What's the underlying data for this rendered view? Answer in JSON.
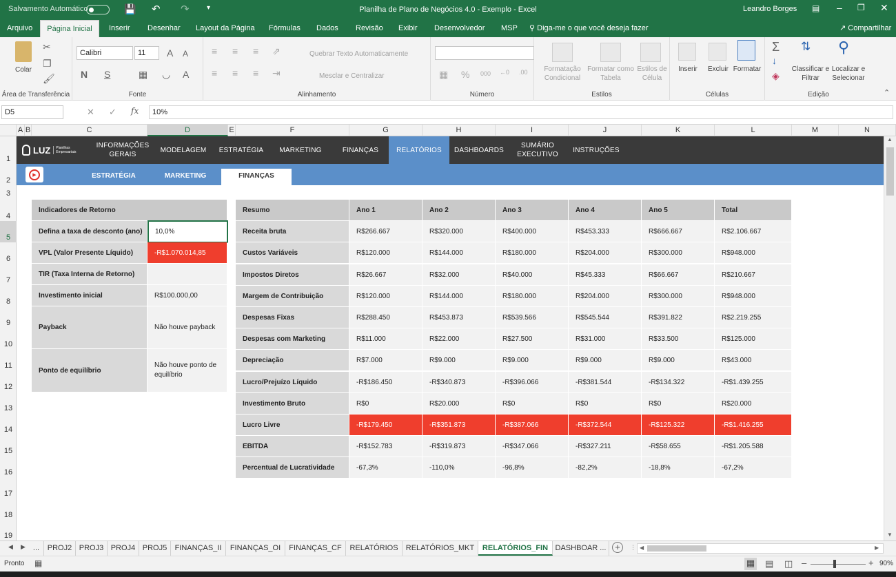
{
  "titlebar": {
    "autosave": "Salvamento Automático",
    "title": "Planilha de Plano de Negócios 4.0 - Exemplo  -  Excel",
    "user": "Leandro Borges"
  },
  "ribbon_tabs": [
    "Arquivo",
    "Página Inicial",
    "Inserir",
    "Desenhar",
    "Layout da Página",
    "Fórmulas",
    "Dados",
    "Revisão",
    "Exibir",
    "Desenvolvedor",
    "MSP"
  ],
  "tell_me": "Diga-me o que você deseja fazer",
  "share": "Compartilhar",
  "ribbon": {
    "paste": "Colar",
    "clipboard": "Área de Transferência",
    "font_name": "Calibri",
    "font_size": "11",
    "font_group": "Fonte",
    "wrap": "Quebrar Texto Automaticamente",
    "merge": "Mesclar e Centralizar",
    "align_group": "Alinhamento",
    "number_group": "Número",
    "cond_format": "Formatação Condicional",
    "format_table": "Formatar como Tabela",
    "cell_styles": "Estilos de Célula",
    "styles_group": "Estilos",
    "insert": "Inserir",
    "delete": "Excluir",
    "format": "Formatar",
    "cells_group": "Células",
    "sort": "Classificar e Filtrar",
    "find": "Localizar e Selecionar",
    "edit_group": "Edição"
  },
  "formula": {
    "namebox": "D5",
    "fx": "fx",
    "value": "10%"
  },
  "columns": [
    "A",
    "B",
    "C",
    "D",
    "E",
    "F",
    "G",
    "H",
    "I",
    "J",
    "K",
    "L",
    "M",
    "N"
  ],
  "rows": [
    "1",
    "2",
    "3",
    "4",
    "5",
    "6",
    "7",
    "8",
    "9",
    "10",
    "11",
    "12",
    "13",
    "14",
    "15",
    "16",
    "17",
    "18",
    "19"
  ],
  "nav": {
    "logo": "LUZ",
    "logo_sub": "Planilhas Empresariais",
    "items": [
      "INFORMAÇÕES GERAIS",
      "MODELAGEM",
      "ESTRATÉGIA",
      "MARKETING",
      "FINANÇAS",
      "RELATÓRIOS",
      "DASHBOARDS",
      "SUMÁRIO EXECUTIVO",
      "INSTRUÇÕES"
    ]
  },
  "subnav": [
    "ESTRATÉGIA",
    "MARKETING",
    "FINANÇAS"
  ],
  "indicators": {
    "header": "Indicadores de Retorno",
    "rows": [
      {
        "label": "Defina a taxa de desconto (ano)",
        "value": "10,0%"
      },
      {
        "label": "VPL (Valor Presente Líquido)",
        "value": "-R$1.070.014,85"
      },
      {
        "label": "TIR (Taxa Interna de Retorno)",
        "value": ""
      },
      {
        "label": "Investimento inicial",
        "value": "R$100.000,00"
      },
      {
        "label": "Payback",
        "value": "Não houve payback"
      },
      {
        "label": "Ponto de equilíbrio",
        "value": "Não houve ponto de equilíbrio"
      }
    ]
  },
  "summary": {
    "headers": [
      "Resumo",
      "Ano 1",
      "Ano 2",
      "Ano 3",
      "Ano 4",
      "Ano 5",
      "Total"
    ],
    "rows": [
      [
        "Receita bruta",
        "R$266.667",
        "R$320.000",
        "R$400.000",
        "R$453.333",
        "R$666.667",
        "R$2.106.667"
      ],
      [
        "Custos Variáveis",
        "R$120.000",
        "R$144.000",
        "R$180.000",
        "R$204.000",
        "R$300.000",
        "R$948.000"
      ],
      [
        "Impostos Diretos",
        "R$26.667",
        "R$32.000",
        "R$40.000",
        "R$45.333",
        "R$66.667",
        "R$210.667"
      ],
      [
        "Margem de Contribuição",
        "R$120.000",
        "R$144.000",
        "R$180.000",
        "R$204.000",
        "R$300.000",
        "R$948.000"
      ],
      [
        "Despesas Fixas",
        "R$288.450",
        "R$453.873",
        "R$539.566",
        "R$545.544",
        "R$391.822",
        "R$2.219.255"
      ],
      [
        "Despesas com Marketing",
        "R$11.000",
        "R$22.000",
        "R$27.500",
        "R$31.000",
        "R$33.500",
        "R$125.000"
      ],
      [
        "Depreciação",
        "R$7.000",
        "R$9.000",
        "R$9.000",
        "R$9.000",
        "R$9.000",
        "R$43.000"
      ],
      [
        "Lucro/Prejuízo Líquido",
        "-R$186.450",
        "-R$340.873",
        "-R$396.066",
        "-R$381.544",
        "-R$134.322",
        "-R$1.439.255"
      ],
      [
        "Investimento Bruto",
        "R$0",
        "R$20.000",
        "R$0",
        "R$0",
        "R$0",
        "R$20.000"
      ],
      [
        "Lucro Livre",
        "-R$179.450",
        "-R$351.873",
        "-R$387.066",
        "-R$372.544",
        "-R$125.322",
        "-R$1.416.255"
      ],
      [
        "EBITDA",
        "-R$152.783",
        "-R$319.873",
        "-R$347.066",
        "-R$327.211",
        "-R$58.655",
        "-R$1.205.588"
      ],
      [
        "Percentual de Lucratividade",
        "-67,3%",
        "-110,0%",
        "-96,8%",
        "-82,2%",
        "-18,8%",
        "-67,2%"
      ]
    ]
  },
  "sheet_tabs": [
    "...",
    "PROJ2",
    "PROJ3",
    "PROJ4",
    "PROJ5",
    "FINANÇAS_II",
    "FINANÇAS_OI",
    "FINANÇAS_CF",
    "RELATÓRIOS",
    "RELATÓRIOS_MKT",
    "RELATÓRIOS_FIN",
    "DASHBOAR ..."
  ],
  "status": {
    "ready": "Pronto",
    "zoom": "90%"
  },
  "colors": {
    "excel_green": "#217346",
    "nav_dark": "#3a3a3a",
    "nav_blue": "#5b8fc9",
    "negative_red": "#ef3e2d"
  }
}
